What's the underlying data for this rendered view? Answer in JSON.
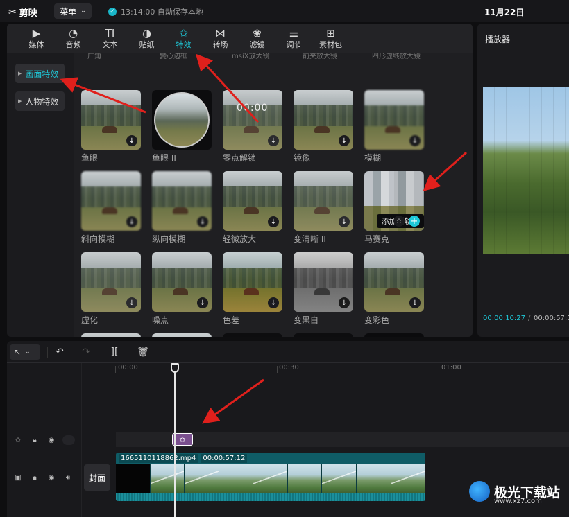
{
  "app": {
    "name": "剪映",
    "menu_label": "菜单",
    "autosave_text": "13:14:00 自动保存本地",
    "date": "11月22日"
  },
  "toolbar": [
    {
      "label": "媒体",
      "icon": "media-icon"
    },
    {
      "label": "音频",
      "icon": "audio-icon"
    },
    {
      "label": "文本",
      "icon": "text-icon"
    },
    {
      "label": "贴纸",
      "icon": "sticker-icon"
    },
    {
      "label": "特效",
      "icon": "effects-icon",
      "active": true
    },
    {
      "label": "转场",
      "icon": "transition-icon"
    },
    {
      "label": "滤镜",
      "icon": "filter-icon"
    },
    {
      "label": "调节",
      "icon": "adjust-icon"
    },
    {
      "label": "素材包",
      "icon": "package-icon"
    }
  ],
  "sidebar": {
    "items": [
      {
        "label": "画面特效",
        "active": true
      },
      {
        "label": "人物特效"
      }
    ]
  },
  "partial_labels": [
    "广角",
    "變心边框",
    "msiX放大镜",
    "前夹放大镜",
    "四形虚线放大镜"
  ],
  "effects": [
    {
      "label": "鱼眼"
    },
    {
      "label": "鱼眼 II"
    },
    {
      "label": "零点解锁",
      "clock": "00:00"
    },
    {
      "label": "镜像"
    },
    {
      "label": "模糊"
    },
    {
      "label": "斜向模糊"
    },
    {
      "label": "纵向模糊"
    },
    {
      "label": "轻微放大"
    },
    {
      "label": "变清晰 II"
    },
    {
      "label": "马赛克"
    },
    {
      "label": "虚化"
    },
    {
      "label": "噪点"
    },
    {
      "label": "色差"
    },
    {
      "label": "变黑白"
    },
    {
      "label": "变彩色"
    }
  ],
  "tooltip": "添加到轨道",
  "player": {
    "title": "播放器",
    "current_time": "00:00:10:27",
    "separator": "/",
    "total_time": "00:00:57:1"
  },
  "timeline": {
    "ruler": [
      "00:00",
      "00:30",
      "01:00"
    ],
    "cover_label": "封面",
    "clip_name": "1665110118862.mp4",
    "clip_duration": "00:00:57:12"
  },
  "watermark": {
    "title": "极光下载站",
    "subtitle": "www.xz7.com"
  },
  "colors": {
    "accent": "#1ec8d8",
    "arrow": "#e0201c",
    "effect_clip": "#7a4f8e",
    "video_clip": "#0f5c66"
  }
}
